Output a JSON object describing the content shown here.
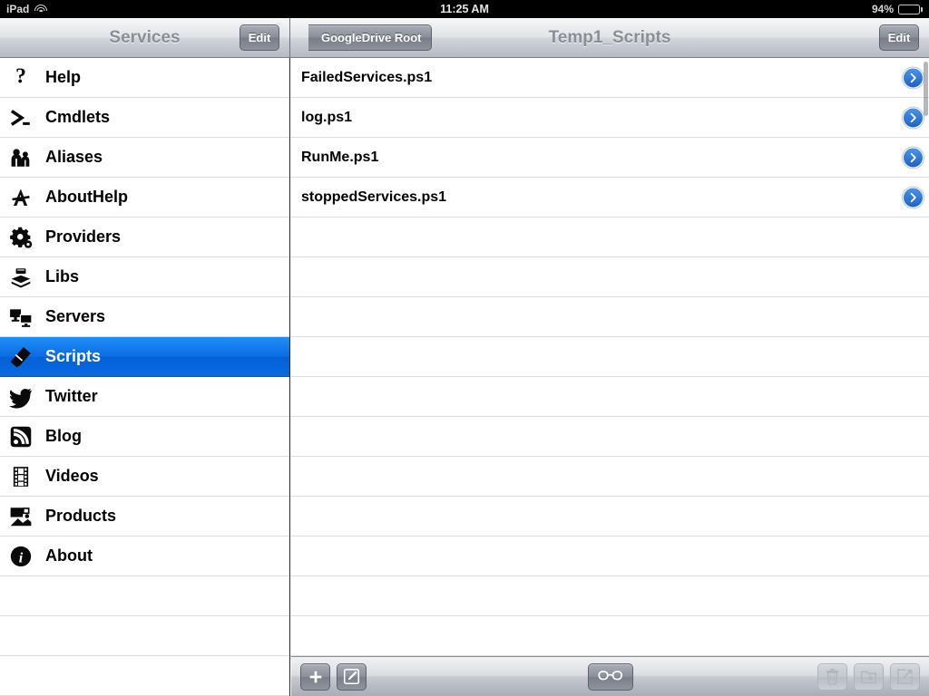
{
  "status_bar": {
    "device": "iPad",
    "wifi_icon": "wifi-icon",
    "time": "11:25 AM",
    "battery_percent": "94%",
    "battery_level": 94
  },
  "sidebar": {
    "title": "Services",
    "edit_label": "Edit",
    "selected_index": 7,
    "items": [
      {
        "label": "Help",
        "icon": "question-mark-icon"
      },
      {
        "label": "Cmdlets",
        "icon": "prompt-icon"
      },
      {
        "label": "Aliases",
        "icon": "people-icon"
      },
      {
        "label": "AboutHelp",
        "icon": "letter-a-icon"
      },
      {
        "label": "Providers",
        "icon": "gear-icon"
      },
      {
        "label": "Libs",
        "icon": "books-icon"
      },
      {
        "label": "Servers",
        "icon": "monitors-icon"
      },
      {
        "label": "Scripts",
        "icon": "script-icon"
      },
      {
        "label": "Twitter",
        "icon": "bird-icon"
      },
      {
        "label": "Blog",
        "icon": "rss-icon"
      },
      {
        "label": "Videos",
        "icon": "film-strip-icon"
      },
      {
        "label": "Products",
        "icon": "products-icon"
      },
      {
        "label": "About",
        "icon": "info-icon"
      }
    ],
    "empty_rows": 3
  },
  "detail": {
    "title": "Temp1_Scripts",
    "back_label": "GoogleDrive Root",
    "edit_label": "Edit",
    "files": [
      {
        "name": "FailedServices.ps1",
        "accessory": "disclosure-icon"
      },
      {
        "name": "log.ps1",
        "accessory": "disclosure-icon"
      },
      {
        "name": "RunMe.ps1",
        "accessory": "disclosure-icon"
      },
      {
        "name": "stoppedServices.ps1",
        "accessory": "disclosure-icon"
      }
    ],
    "empty_rows": 11
  },
  "toolbar": {
    "left": [
      {
        "name": "add-button",
        "icon": "plus-icon",
        "enabled": true
      },
      {
        "name": "edit-button",
        "icon": "compose-icon",
        "enabled": true
      }
    ],
    "center": [
      {
        "name": "link-button",
        "icon": "glasses-icon",
        "enabled": true
      }
    ],
    "right": [
      {
        "name": "delete-button",
        "icon": "trash-icon",
        "enabled": false
      },
      {
        "name": "download-button",
        "icon": "folder-down-icon",
        "enabled": false
      },
      {
        "name": "share-button",
        "icon": "share-icon",
        "enabled": false
      }
    ]
  },
  "colors": {
    "selection_blue": "#0b6ce2",
    "disclosure_blue": "#1d63c9",
    "nav_title_gray": "#8b8e95",
    "separator": "#dcdcdc"
  }
}
